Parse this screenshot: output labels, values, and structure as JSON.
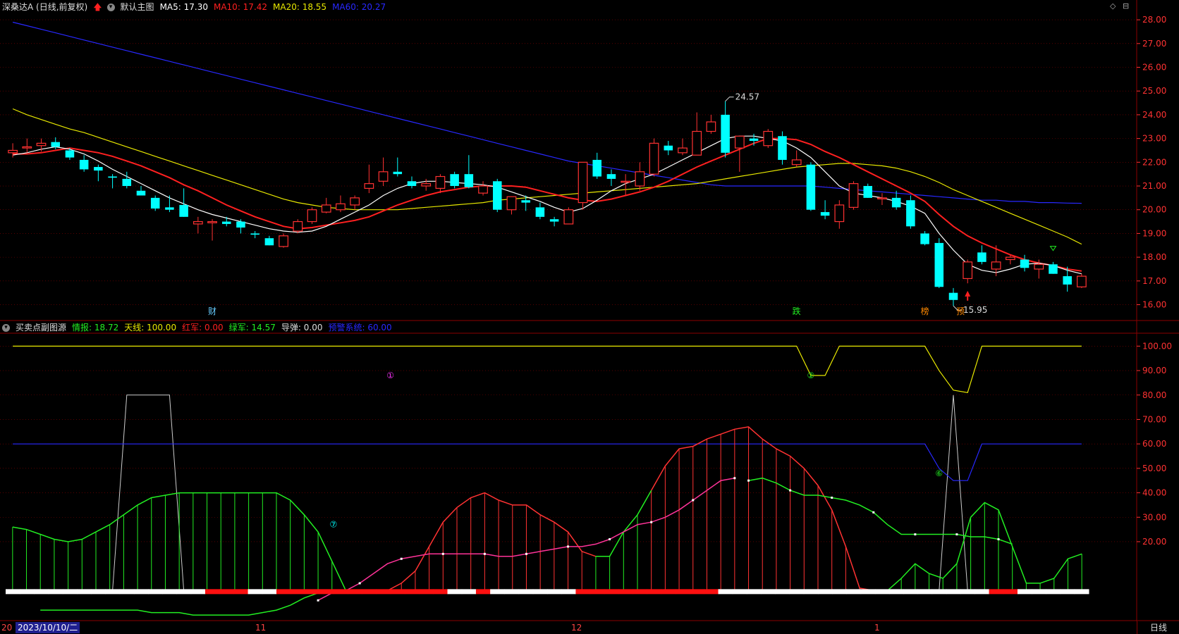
{
  "main_header": {
    "stock": "深桑达A (日线,前复权)",
    "template": "默认主图",
    "ma5_label": "MA5: 17.30",
    "ma10_label": "MA10: 17.42",
    "ma20_label": "MA20: 18.55",
    "ma60_label": "MA60: 20.27"
  },
  "sub_header": {
    "indicator": "买卖点副图源",
    "qingbao": "情报: 18.72",
    "tianxian": "天线: 100.00",
    "hongjun": "红军: 0.00",
    "lvjun": "绿军: 14.57",
    "daodan": "导弹: 0.00",
    "yujing": "预警系统: 60.00"
  },
  "colors": {
    "up": "#ff3232",
    "down": "#00ffff",
    "ma5": "#ffffff",
    "ma10": "#ff2020",
    "ma20": "#e8e800",
    "ma60": "#2828ff",
    "grid": "#8b0000",
    "green": "#22ee22",
    "magenta": "#ff3399",
    "yellow": "#e8e800",
    "blue": "#2828ff"
  },
  "price_axis": [
    "28.00",
    "27.00",
    "26.00",
    "25.00",
    "24.00",
    "23.00",
    "22.00",
    "21.00",
    "20.00",
    "19.00",
    "18.00",
    "17.00",
    "16.00"
  ],
  "ind_axis": [
    "100.00",
    "90.00",
    "80.00",
    "70.00",
    "60.00",
    "50.00",
    "40.00",
    "30.00",
    "20.00"
  ],
  "annotations": {
    "high": "24.57",
    "low": "15.95",
    "cai": "财",
    "die": "跌",
    "bang": "榜",
    "yu": "预",
    "c1": "①",
    "c2": "②",
    "c6": "⑥",
    "c7": "⑦"
  },
  "x_axis": {
    "first": "20",
    "date": "2023/10/10/二",
    "nov": "11",
    "dec": "12",
    "jan": "1",
    "period": "日线"
  },
  "chart_data": {
    "type": "candlestick",
    "candles": [
      {
        "o": 22.4,
        "h": 22.8,
        "l": 22.2,
        "c": 22.5
      },
      {
        "o": 22.6,
        "h": 23.0,
        "l": 22.4,
        "c": 22.65
      },
      {
        "o": 22.7,
        "h": 23.0,
        "l": 22.45,
        "c": 22.8
      },
      {
        "o": 22.85,
        "h": 23.05,
        "l": 22.55,
        "c": 22.65
      },
      {
        "o": 22.5,
        "h": 22.6,
        "l": 22.1,
        "c": 22.2
      },
      {
        "o": 22.1,
        "h": 22.3,
        "l": 21.6,
        "c": 21.7
      },
      {
        "o": 21.8,
        "h": 21.9,
        "l": 21.2,
        "c": 21.65
      },
      {
        "o": 21.4,
        "h": 21.5,
        "l": 20.9,
        "c": 21.35
      },
      {
        "o": 21.3,
        "h": 21.6,
        "l": 20.9,
        "c": 21.0
      },
      {
        "o": 20.8,
        "h": 21.0,
        "l": 20.6,
        "c": 20.6
      },
      {
        "o": 20.5,
        "h": 20.6,
        "l": 19.95,
        "c": 20.05
      },
      {
        "o": 20.1,
        "h": 20.6,
        "l": 19.9,
        "c": 20.0
      },
      {
        "o": 20.2,
        "h": 20.9,
        "l": 19.7,
        "c": 19.7
      },
      {
        "o": 19.4,
        "h": 19.7,
        "l": 19.0,
        "c": 19.5
      },
      {
        "o": 19.45,
        "h": 19.6,
        "l": 18.7,
        "c": 19.5
      },
      {
        "o": 19.5,
        "h": 19.7,
        "l": 19.3,
        "c": 19.4
      },
      {
        "o": 19.5,
        "h": 19.6,
        "l": 19.0,
        "c": 19.25
      },
      {
        "o": 19.0,
        "h": 19.1,
        "l": 18.8,
        "c": 18.95
      },
      {
        "o": 18.8,
        "h": 18.9,
        "l": 18.5,
        "c": 18.5
      },
      {
        "o": 18.45,
        "h": 19.0,
        "l": 18.4,
        "c": 18.9
      },
      {
        "o": 19.1,
        "h": 19.6,
        "l": 19.0,
        "c": 19.5
      },
      {
        "o": 19.5,
        "h": 20.1,
        "l": 19.4,
        "c": 20.0
      },
      {
        "o": 19.9,
        "h": 20.5,
        "l": 19.85,
        "c": 20.2
      },
      {
        "o": 20.0,
        "h": 20.6,
        "l": 19.9,
        "c": 20.25
      },
      {
        "o": 20.2,
        "h": 20.6,
        "l": 20.0,
        "c": 20.5
      },
      {
        "o": 20.9,
        "h": 21.9,
        "l": 20.7,
        "c": 21.1
      },
      {
        "o": 21.2,
        "h": 22.2,
        "l": 21.0,
        "c": 21.6
      },
      {
        "o": 21.6,
        "h": 22.2,
        "l": 21.4,
        "c": 21.5
      },
      {
        "o": 21.2,
        "h": 21.4,
        "l": 20.9,
        "c": 21.0
      },
      {
        "o": 21.0,
        "h": 21.3,
        "l": 20.8,
        "c": 21.1
      },
      {
        "o": 20.9,
        "h": 21.5,
        "l": 20.7,
        "c": 21.4
      },
      {
        "o": 21.5,
        "h": 21.6,
        "l": 20.9,
        "c": 21.0
      },
      {
        "o": 21.5,
        "h": 22.3,
        "l": 20.9,
        "c": 20.95
      },
      {
        "o": 20.7,
        "h": 21.2,
        "l": 20.6,
        "c": 21.0
      },
      {
        "o": 21.2,
        "h": 21.3,
        "l": 19.9,
        "c": 20.0
      },
      {
        "o": 20.0,
        "h": 20.5,
        "l": 19.8,
        "c": 20.55
      },
      {
        "o": 20.4,
        "h": 20.6,
        "l": 19.95,
        "c": 20.3
      },
      {
        "o": 20.1,
        "h": 20.3,
        "l": 19.6,
        "c": 19.7
      },
      {
        "o": 19.6,
        "h": 19.7,
        "l": 19.3,
        "c": 19.5
      },
      {
        "o": 19.4,
        "h": 20.1,
        "l": 19.4,
        "c": 20.0
      },
      {
        "o": 20.3,
        "h": 22.0,
        "l": 20.0,
        "c": 22.0
      },
      {
        "o": 22.1,
        "h": 22.4,
        "l": 21.3,
        "c": 21.4
      },
      {
        "o": 21.5,
        "h": 21.7,
        "l": 21.0,
        "c": 21.3
      },
      {
        "o": 21.2,
        "h": 21.5,
        "l": 20.6,
        "c": 21.2
      },
      {
        "o": 21.0,
        "h": 22.0,
        "l": 20.8,
        "c": 21.6
      },
      {
        "o": 21.5,
        "h": 23.0,
        "l": 21.4,
        "c": 22.8
      },
      {
        "o": 22.7,
        "h": 22.9,
        "l": 22.3,
        "c": 22.5
      },
      {
        "o": 22.4,
        "h": 23.0,
        "l": 22.3,
        "c": 22.6
      },
      {
        "o": 22.3,
        "h": 24.1,
        "l": 22.3,
        "c": 23.3
      },
      {
        "o": 23.3,
        "h": 24.0,
        "l": 23.2,
        "c": 23.7
      },
      {
        "o": 24.0,
        "h": 24.57,
        "l": 22.2,
        "c": 22.4
      },
      {
        "o": 22.6,
        "h": 23.1,
        "l": 21.6,
        "c": 23.1
      },
      {
        "o": 23.0,
        "h": 23.2,
        "l": 22.7,
        "c": 22.9
      },
      {
        "o": 22.7,
        "h": 23.4,
        "l": 22.6,
        "c": 23.3
      },
      {
        "o": 23.1,
        "h": 23.3,
        "l": 21.9,
        "c": 22.1
      },
      {
        "o": 21.9,
        "h": 22.5,
        "l": 21.8,
        "c": 22.1
      },
      {
        "o": 21.9,
        "h": 22.0,
        "l": 19.95,
        "c": 20.0
      },
      {
        "o": 19.9,
        "h": 20.4,
        "l": 19.6,
        "c": 19.75
      },
      {
        "o": 19.5,
        "h": 20.4,
        "l": 19.2,
        "c": 20.2
      },
      {
        "o": 20.1,
        "h": 21.2,
        "l": 20.0,
        "c": 21.1
      },
      {
        "o": 21.0,
        "h": 21.1,
        "l": 20.5,
        "c": 20.5
      },
      {
        "o": 20.5,
        "h": 20.7,
        "l": 20.2,
        "c": 20.5
      },
      {
        "o": 20.5,
        "h": 20.8,
        "l": 20.0,
        "c": 20.1
      },
      {
        "o": 20.4,
        "h": 20.6,
        "l": 19.2,
        "c": 19.3
      },
      {
        "o": 19.0,
        "h": 19.1,
        "l": 18.5,
        "c": 18.55
      },
      {
        "o": 18.6,
        "h": 18.8,
        "l": 16.7,
        "c": 16.75
      },
      {
        "o": 16.5,
        "h": 16.7,
        "l": 15.95,
        "c": 16.2
      },
      {
        "o": 17.1,
        "h": 17.9,
        "l": 16.9,
        "c": 17.8
      },
      {
        "o": 18.2,
        "h": 18.5,
        "l": 17.7,
        "c": 17.8
      },
      {
        "o": 17.5,
        "h": 18.5,
        "l": 17.2,
        "c": 17.8
      },
      {
        "o": 17.9,
        "h": 18.1,
        "l": 17.7,
        "c": 18.0
      },
      {
        "o": 17.9,
        "h": 18.1,
        "l": 17.4,
        "c": 17.55
      },
      {
        "o": 17.5,
        "h": 17.9,
        "l": 17.1,
        "c": 17.7
      },
      {
        "o": 17.7,
        "h": 17.8,
        "l": 17.3,
        "c": 17.3
      },
      {
        "o": 17.2,
        "h": 17.6,
        "l": 16.55,
        "c": 16.85
      },
      {
        "o": 16.75,
        "h": 17.3,
        "l": 16.7,
        "c": 17.2
      }
    ],
    "ma5": [
      22.3,
      22.4,
      22.55,
      22.65,
      22.55,
      22.35,
      22.05,
      21.7,
      21.4,
      21.1,
      20.8,
      20.5,
      20.25,
      20.0,
      19.8,
      19.65,
      19.5,
      19.35,
      19.2,
      19.1,
      19.05,
      19.1,
      19.3,
      19.6,
      19.9,
      20.2,
      20.6,
      20.9,
      21.1,
      21.2,
      21.2,
      21.15,
      21.1,
      21.05,
      20.95,
      20.75,
      20.55,
      20.35,
      20.1,
      19.9,
      20.05,
      20.4,
      20.8,
      21.1,
      21.3,
      21.5,
      21.8,
      22.1,
      22.4,
      22.7,
      23.0,
      23.1,
      23.1,
      23.0,
      22.9,
      22.6,
      22.2,
      21.6,
      21.0,
      20.7,
      20.6,
      20.5,
      20.35,
      20.15,
      19.85,
      19.0,
      18.3,
      17.7,
      17.45,
      17.35,
      17.5,
      17.7,
      17.75,
      17.65,
      17.45,
      17.3
    ],
    "ma10": [
      22.35,
      22.35,
      22.4,
      22.5,
      22.6,
      22.5,
      22.4,
      22.25,
      22.05,
      21.85,
      21.6,
      21.35,
      21.05,
      20.8,
      20.5,
      20.2,
      19.95,
      19.7,
      19.5,
      19.3,
      19.2,
      19.25,
      19.35,
      19.45,
      19.55,
      19.7,
      19.95,
      20.2,
      20.4,
      20.6,
      20.75,
      20.85,
      20.95,
      21.0,
      21.0,
      21.0,
      20.95,
      20.8,
      20.65,
      20.5,
      20.4,
      20.35,
      20.45,
      20.6,
      20.75,
      20.95,
      21.2,
      21.5,
      21.8,
      22.05,
      22.3,
      22.55,
      22.8,
      23.0,
      23.0,
      22.95,
      22.75,
      22.45,
      22.2,
      21.9,
      21.6,
      21.3,
      21.0,
      20.7,
      20.35,
      19.8,
      19.3,
      18.9,
      18.6,
      18.35,
      18.1,
      17.9,
      17.75,
      17.65,
      17.5,
      17.42
    ],
    "ma20": [
      24.25,
      24.0,
      23.8,
      23.6,
      23.4,
      23.25,
      23.05,
      22.85,
      22.65,
      22.45,
      22.25,
      22.05,
      21.85,
      21.65,
      21.45,
      21.25,
      21.05,
      20.85,
      20.65,
      20.45,
      20.3,
      20.2,
      20.1,
      20.05,
      20.0,
      20.0,
      20.0,
      20.0,
      20.05,
      20.1,
      20.15,
      20.2,
      20.25,
      20.3,
      20.4,
      20.45,
      20.5,
      20.55,
      20.6,
      20.65,
      20.7,
      20.75,
      20.8,
      20.85,
      20.9,
      20.95,
      21.0,
      21.05,
      21.1,
      21.2,
      21.3,
      21.4,
      21.5,
      21.6,
      21.7,
      21.8,
      21.85,
      21.9,
      21.95,
      21.95,
      21.9,
      21.85,
      21.75,
      21.6,
      21.4,
      21.15,
      20.85,
      20.6,
      20.35,
      20.1,
      19.85,
      19.6,
      19.35,
      19.1,
      18.85,
      18.55
    ],
    "ma60": [
      27.9,
      27.75,
      27.6,
      27.45,
      27.3,
      27.15,
      27.0,
      26.85,
      26.7,
      26.55,
      26.4,
      26.25,
      26.1,
      25.95,
      25.8,
      25.65,
      25.5,
      25.35,
      25.2,
      25.05,
      24.9,
      24.75,
      24.6,
      24.45,
      24.3,
      24.15,
      24.0,
      23.85,
      23.7,
      23.55,
      23.4,
      23.25,
      23.1,
      22.95,
      22.8,
      22.65,
      22.5,
      22.35,
      22.2,
      22.05,
      21.95,
      21.85,
      21.75,
      21.65,
      21.55,
      21.45,
      21.35,
      21.25,
      21.15,
      21.05,
      21.0,
      21.0,
      21.0,
      21.0,
      21.0,
      21.0,
      21.0,
      20.95,
      20.9,
      20.85,
      20.8,
      20.75,
      20.7,
      20.65,
      20.6,
      20.55,
      20.5,
      20.45,
      20.4,
      20.4,
      20.35,
      20.35,
      20.3,
      20.3,
      20.28,
      20.27
    ],
    "tianxian": [
      100,
      100,
      100,
      100,
      100,
      100,
      100,
      100,
      100,
      100,
      100,
      100,
      100,
      100,
      100,
      100,
      100,
      100,
      100,
      100,
      100,
      100,
      100,
      100,
      100,
      100,
      100,
      100,
      100,
      100,
      100,
      100,
      100,
      100,
      100,
      100,
      100,
      100,
      100,
      100,
      100,
      100,
      100,
      100,
      100,
      100,
      100,
      100,
      100,
      100,
      100,
      100,
      100,
      100,
      100,
      100,
      88,
      88,
      100,
      100,
      100,
      100,
      100,
      100,
      100,
      90,
      82,
      81,
      100,
      100,
      100,
      100,
      100,
      100,
      100,
      100
    ],
    "qingbao": [
      26,
      25,
      23,
      21,
      20,
      21,
      24,
      27,
      31,
      35,
      38,
      39,
      40,
      40,
      40,
      40,
      40,
      40,
      40,
      40,
      37,
      31,
      24,
      12,
      0,
      0,
      0,
      0,
      3,
      8,
      18,
      28,
      34,
      38,
      40,
      37,
      35,
      35,
      31,
      28,
      24,
      16,
      14,
      14,
      24,
      31,
      41,
      51,
      58,
      59,
      62,
      64,
      66,
      67,
      62,
      58,
      55,
      50,
      43,
      33,
      18,
      1,
      0,
      0,
      5,
      11,
      7,
      5,
      11,
      30,
      36,
      33,
      18,
      3,
      3,
      5,
      13,
      15
    ],
    "magenta": [
      -8,
      -8,
      -8,
      -8,
      -8,
      -8,
      -8,
      -8,
      -8,
      -8,
      -8,
      -8,
      -8,
      -8,
      -8,
      -8,
      -8,
      -8,
      -8,
      -8,
      -8,
      -8,
      -4,
      -1,
      0,
      3,
      7,
      11,
      13,
      14,
      15,
      15,
      15,
      15,
      15,
      14,
      14,
      15,
      16,
      17,
      18,
      18,
      19,
      21,
      24,
      27,
      28,
      30,
      33,
      37,
      41,
      45,
      46
    ],
    "lvjun": [
      -8,
      -8,
      -8,
      -8,
      -8,
      -8,
      -8,
      -8,
      -9,
      -9,
      -9,
      -10,
      -10,
      -10,
      -10,
      -10,
      -9,
      -8,
      -6,
      -3,
      -1
    ],
    "lvjun_tail": [
      45,
      46,
      44,
      41,
      39,
      39,
      38,
      37,
      35,
      32,
      27,
      23,
      23,
      23,
      23,
      23,
      22,
      22,
      21,
      19
    ],
    "white_line": [
      0,
      0,
      0,
      0,
      0,
      0,
      0,
      0,
      80,
      80,
      80,
      80,
      0,
      0,
      0,
      0,
      0,
      0,
      0,
      0,
      0,
      0,
      0,
      0,
      0,
      0,
      0,
      0,
      0,
      0,
      0,
      0,
      0,
      0,
      0,
      0,
      0,
      0,
      0,
      0,
      0,
      0,
      0,
      0,
      0,
      0,
      0,
      0,
      0,
      0,
      0,
      0,
      0,
      0,
      0,
      0,
      0,
      0,
      0,
      0,
      0,
      0,
      0,
      0,
      0,
      0,
      80,
      0,
      0,
      0,
      0,
      0,
      0,
      0,
      0,
      0
    ],
    "yujing": [
      60,
      60,
      60,
      60,
      60,
      60,
      60,
      60,
      60,
      60,
      60,
      60,
      60,
      60,
      60,
      60,
      60,
      60,
      60,
      60,
      60,
      60,
      60,
      60,
      60,
      60,
      60,
      60,
      60,
      60,
      60,
      60,
      60,
      60,
      60,
      60,
      60,
      60,
      60,
      60,
      60,
      60,
      60,
      60,
      60,
      60,
      60,
      60,
      60,
      60,
      60,
      60,
      60,
      60,
      60,
      60,
      60,
      60,
      60,
      60,
      60,
      60,
      60,
      60,
      60,
      50,
      45,
      45,
      60,
      60,
      60,
      60,
      60,
      60,
      60,
      60
    ],
    "signal_bar": [
      "w",
      "w",
      "w",
      "w",
      "w",
      "w",
      "w",
      "w",
      "w",
      "w",
      "w",
      "w",
      "w",
      "w",
      "r",
      "r",
      "r",
      "w",
      "w",
      "r",
      "r",
      "r",
      "r",
      "r",
      "r",
      "r",
      "r",
      "r",
      "r",
      "r",
      "r",
      "w",
      "w",
      "r",
      "w",
      "w",
      "w",
      "w",
      "w",
      "w",
      "r",
      "r",
      "r",
      "r",
      "r",
      "r",
      "r",
      "r",
      "r",
      "r",
      "w",
      "w",
      "w",
      "w",
      "w",
      "w",
      "w",
      "w",
      "w",
      "w",
      "w",
      "w",
      "w",
      "w",
      "w",
      "w",
      "w",
      "w",
      "w",
      "r",
      "r",
      "w",
      "w",
      "w",
      "w",
      "w"
    ]
  }
}
